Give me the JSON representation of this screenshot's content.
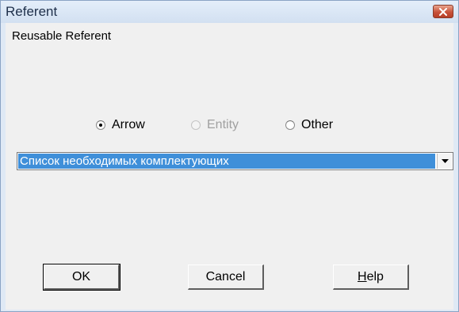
{
  "window": {
    "title": "Referent"
  },
  "dialog": {
    "caption": "Reusable Referent",
    "radios": [
      {
        "label": "Arrow",
        "checked": true,
        "enabled": true
      },
      {
        "label": "Entity",
        "checked": false,
        "enabled": false
      },
      {
        "label": "Other",
        "checked": false,
        "enabled": true
      }
    ],
    "combo": {
      "value": "Список необходимых комплектующих"
    },
    "buttons": {
      "ok": "OK",
      "cancel": "Cancel",
      "help_mnemonic": "H",
      "help_rest": "elp"
    }
  },
  "icons": {
    "close": "close-icon",
    "dropdown": "chevron-down-icon"
  },
  "colors": {
    "selection": "#3f8fd9",
    "close_button": "#c8523a",
    "dialog_bg": "#f0f0f0"
  }
}
